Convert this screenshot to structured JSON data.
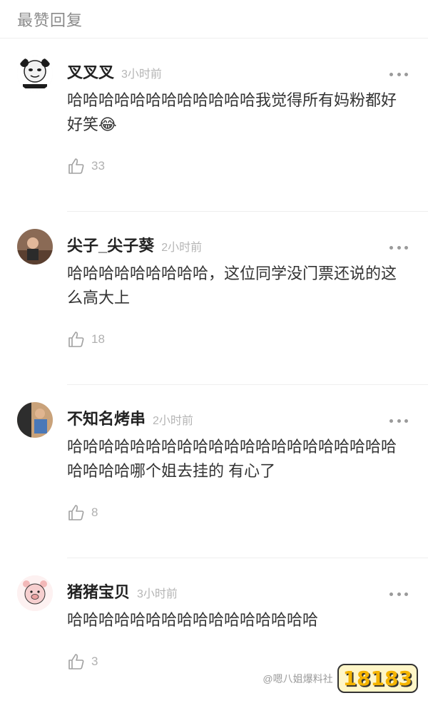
{
  "header": {
    "title": "最赞回复"
  },
  "comments": [
    {
      "user": "叉叉叉",
      "time": "3小时前",
      "text": "哈哈哈哈哈哈哈哈哈哈哈哈我觉得所有妈粉都好好笑😂",
      "likes": "33",
      "avatar_color": "#1c1c1c"
    },
    {
      "user": "尖子_尖子葵",
      "time": "2小时前",
      "text": "哈哈哈哈哈哈哈哈哈，这位同学没门票还说的这么高大上",
      "likes": "18",
      "avatar_color": "#6b4a3a"
    },
    {
      "user": "不知名烤串",
      "time": "2小时前",
      "text": "哈哈哈哈哈哈哈哈哈哈哈哈哈哈哈哈哈哈哈哈哈哈哈哈哈哪个姐去挂的 有心了",
      "likes": "8",
      "avatar_color": "#3d4f6b"
    },
    {
      "user": "猪猪宝贝",
      "time": "3小时前",
      "text": "哈哈哈哈哈哈哈哈哈哈哈哈哈哈哈哈",
      "likes": "3",
      "avatar_color": "#f4c9c9"
    }
  ],
  "watermark": {
    "logo": "18183",
    "text": "@嗯八姐爆料社"
  }
}
